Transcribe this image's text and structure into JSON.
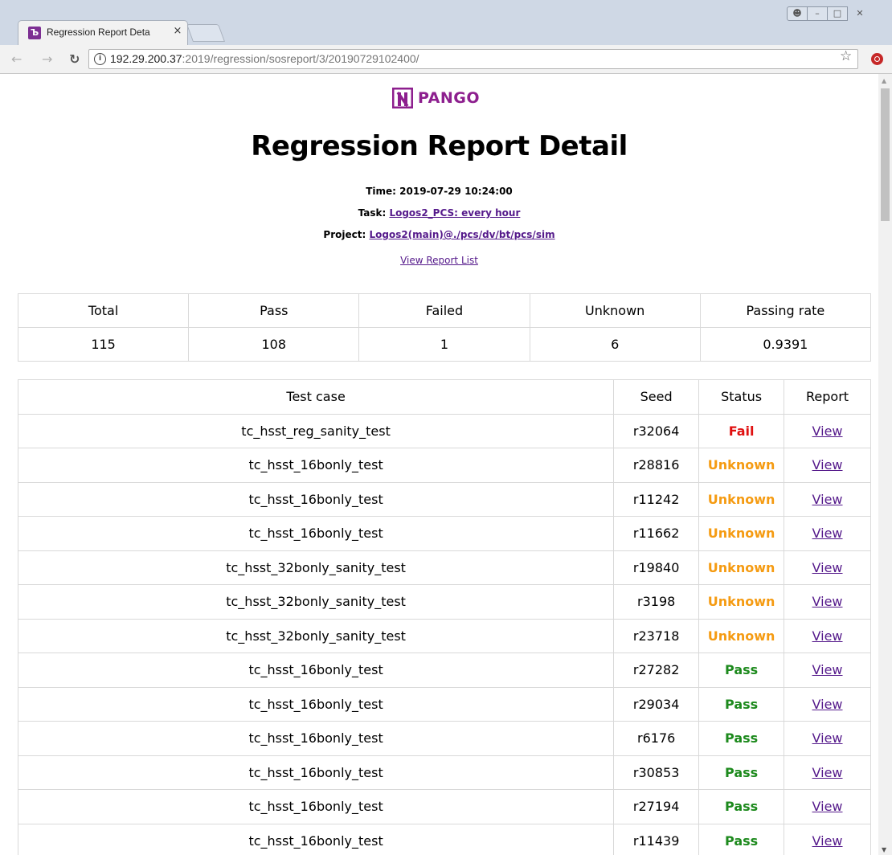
{
  "browser": {
    "tab_title": "Regression Report Deta",
    "tab_close": "×",
    "url_host": "192.29.200.37",
    "url_path": ":2019/regression/sosreport/3/20190729102400/"
  },
  "brand": {
    "name": "PANGO",
    "color": "#8d1f8e"
  },
  "header": {
    "title": "Regression Report Detail",
    "time_label": "Time: ",
    "time_value": "2019-07-29 10:24:00",
    "task_label": "Task: ",
    "task_value": "Logos2_PCS: every hour",
    "project_label": "Project: ",
    "project_value": "Logos2(main)@./pcs/dv/bt/pcs/sim",
    "view_list": "View Report List"
  },
  "summary": {
    "headers": [
      "Total",
      "Pass",
      "Failed",
      "Unknown",
      "Passing rate"
    ],
    "values": [
      "115",
      "108",
      "1",
      "6",
      "0.9391"
    ]
  },
  "cases": {
    "headers": [
      "Test case",
      "Seed",
      "Status",
      "Report"
    ],
    "status_colors": {
      "Fail": "#e01010",
      "Unknown": "#f59b12",
      "Pass": "#1d8a1d"
    },
    "rows": [
      {
        "name": "tc_hsst_reg_sanity_test",
        "seed": "r32064",
        "status": "Fail",
        "report": "View"
      },
      {
        "name": "tc_hsst_16bonly_test",
        "seed": "r28816",
        "status": "Unknown",
        "report": "View"
      },
      {
        "name": "tc_hsst_16bonly_test",
        "seed": "r11242",
        "status": "Unknown",
        "report": "View"
      },
      {
        "name": "tc_hsst_16bonly_test",
        "seed": "r11662",
        "status": "Unknown",
        "report": "View"
      },
      {
        "name": "tc_hsst_32bonly_sanity_test",
        "seed": "r19840",
        "status": "Unknown",
        "report": "View"
      },
      {
        "name": "tc_hsst_32bonly_sanity_test",
        "seed": "r3198",
        "status": "Unknown",
        "report": "View"
      },
      {
        "name": "tc_hsst_32bonly_sanity_test",
        "seed": "r23718",
        "status": "Unknown",
        "report": "View"
      },
      {
        "name": "tc_hsst_16bonly_test",
        "seed": "r27282",
        "status": "Pass",
        "report": "View"
      },
      {
        "name": "tc_hsst_16bonly_test",
        "seed": "r29034",
        "status": "Pass",
        "report": "View"
      },
      {
        "name": "tc_hsst_16bonly_test",
        "seed": "r6176",
        "status": "Pass",
        "report": "View"
      },
      {
        "name": "tc_hsst_16bonly_test",
        "seed": "r30853",
        "status": "Pass",
        "report": "View"
      },
      {
        "name": "tc_hsst_16bonly_test",
        "seed": "r27194",
        "status": "Pass",
        "report": "View"
      },
      {
        "name": "tc_hsst_16bonly_test",
        "seed": "r11439",
        "status": "Pass",
        "report": "View"
      }
    ]
  }
}
